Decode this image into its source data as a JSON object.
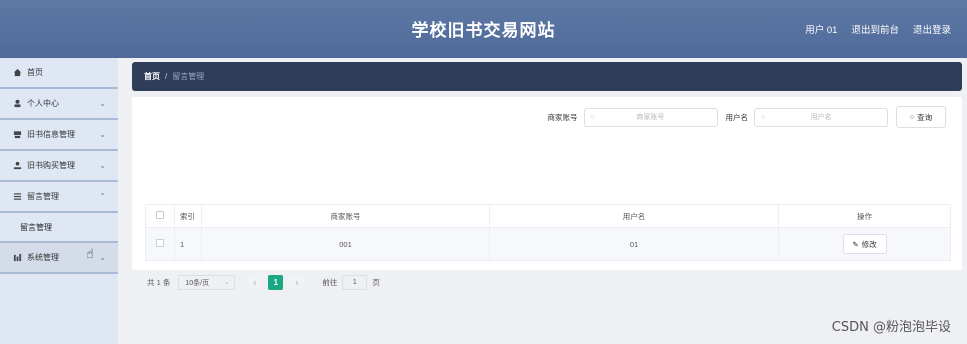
{
  "header": {
    "title": "学校旧书交易网站",
    "user": "用户 01",
    "back_to_admin": "退出到前台",
    "logout": "退出登录"
  },
  "sidebar": {
    "items": [
      {
        "label": "首页",
        "icon": "home-icon",
        "arrow": ""
      },
      {
        "label": "个人中心",
        "icon": "user-icon",
        "arrow": "⌄"
      },
      {
        "label": "旧书信息管理",
        "icon": "book-icon",
        "arrow": "⌄"
      },
      {
        "label": "旧书购买管理",
        "icon": "cart-icon",
        "arrow": "⌄"
      },
      {
        "label": "留言管理",
        "icon": "list-icon",
        "arrow": "⌃"
      },
      {
        "label": "系统管理",
        "icon": "settings-icon",
        "arrow": "⌄"
      }
    ],
    "submenu": {
      "label": "留言管理"
    }
  },
  "breadcrumb": {
    "home": "首页",
    "separator": "/",
    "current": "留言管理"
  },
  "search": {
    "merchant_label": "商家账号",
    "merchant_placeholder": "商家账号",
    "user_label": "用户名",
    "user_placeholder": "用户名",
    "button": "查询"
  },
  "table": {
    "headers": [
      "索引",
      "商家账号",
      "用户名",
      "操作"
    ],
    "rows": [
      {
        "index": "1",
        "merchant": "001",
        "user": "01",
        "action": "修改"
      }
    ]
  },
  "pagination": {
    "total": "共 1 条",
    "page_size": "10条/页",
    "prev": "‹",
    "current_page": "1",
    "next": "›",
    "goto_label": "前往",
    "goto_value": "1",
    "page_unit": "页"
  },
  "watermark": "CSDN @粉泡泡毕设"
}
